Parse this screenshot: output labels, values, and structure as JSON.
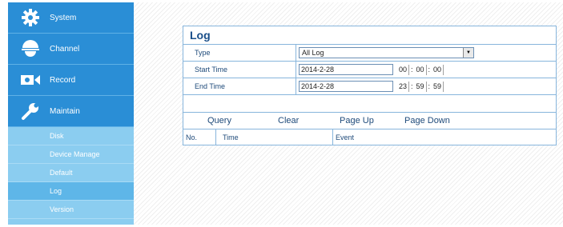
{
  "sidebar": {
    "main": [
      {
        "label": "System",
        "icon": "gear-icon"
      },
      {
        "label": "Channel",
        "icon": "camera-icon"
      },
      {
        "label": "Record",
        "icon": "video-camera-icon"
      },
      {
        "label": "Maintain",
        "icon": "wrench-icon"
      }
    ],
    "sub": [
      {
        "label": "Disk"
      },
      {
        "label": "Device Manage"
      },
      {
        "label": "Default"
      },
      {
        "label": "Log",
        "active": true
      },
      {
        "label": "Version"
      }
    ]
  },
  "log": {
    "title": "Log",
    "type_label": "Type",
    "type_value": "All Log",
    "start_label": "Start Time",
    "start_date": "2014-2-28",
    "start_hh": "00",
    "start_mm": "00",
    "start_ss": "00",
    "end_label": "End Time",
    "end_date": "2014-2-28",
    "end_hh": "23",
    "end_mm": "59",
    "end_ss": "59",
    "buttons": {
      "query": "Query",
      "clear": "Clear",
      "page_up": "Page Up",
      "page_down": "Page Down"
    },
    "columns": {
      "no": "No.",
      "time": "Time",
      "event": "Event"
    }
  },
  "colors": {
    "accent": "#2a8ed6",
    "sub_nav": "#8bcdf0",
    "active": "#5eb6e8",
    "title": "#1a4f8a"
  }
}
